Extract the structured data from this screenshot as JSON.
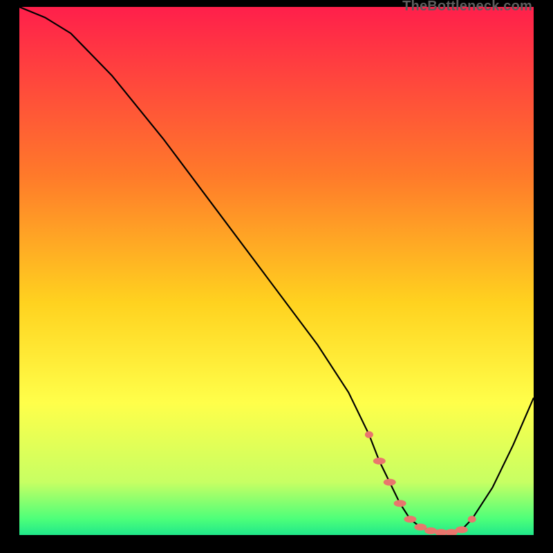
{
  "watermark": "TheBottleneck.com",
  "colors": {
    "gradient_top": "#ff1f4b",
    "gradient_mid1": "#ff7a2a",
    "gradient_mid2": "#ffd21f",
    "gradient_mid3": "#ffff4a",
    "gradient_bottom1": "#c7ff63",
    "gradient_bottom2": "#4cff7a",
    "gradient_bottom3": "#20e88a",
    "curve": "#000000",
    "marker": "#e9766d"
  },
  "chart_data": {
    "type": "line",
    "title": "",
    "xlabel": "",
    "ylabel": "",
    "xlim": [
      0,
      100
    ],
    "ylim": [
      0,
      100
    ],
    "series": [
      {
        "name": "bottleneck-curve",
        "x": [
          0,
          5,
          10,
          18,
          28,
          38,
          48,
          58,
          64,
          68,
          70,
          72,
          74,
          76,
          78,
          80,
          82,
          84,
          86,
          88,
          92,
          96,
          100
        ],
        "y": [
          100,
          98,
          95,
          87,
          75,
          62,
          49,
          36,
          27,
          19,
          14,
          10,
          6,
          3,
          1.5,
          0.8,
          0.5,
          0.5,
          1,
          3,
          9,
          17,
          26
        ]
      }
    ],
    "markers": {
      "name": "highlight-segment",
      "x": [
        68,
        70,
        72,
        74,
        76,
        78,
        80,
        82,
        84,
        86,
        88
      ],
      "y": [
        19,
        14,
        10,
        6,
        3,
        1.5,
        0.8,
        0.5,
        0.5,
        1,
        3
      ]
    }
  }
}
